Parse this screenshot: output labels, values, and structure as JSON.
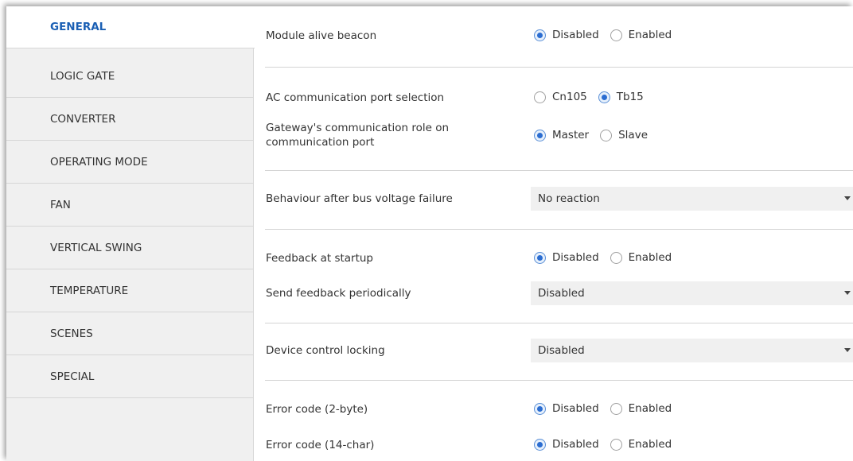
{
  "sidebar": {
    "items": [
      {
        "label": "GENERAL"
      },
      {
        "label": "LOGIC GATE"
      },
      {
        "label": "CONVERTER"
      },
      {
        "label": "OPERATING MODE"
      },
      {
        "label": "FAN"
      },
      {
        "label": "VERTICAL SWING"
      },
      {
        "label": "TEMPERATURE"
      },
      {
        "label": "SCENES"
      },
      {
        "label": "SPECIAL"
      }
    ]
  },
  "settings": {
    "beacon": {
      "label": "Module alive beacon",
      "opt1": "Disabled",
      "opt2": "Enabled",
      "selected": "Disabled"
    },
    "port": {
      "label": "AC communication port selection",
      "opt1": "Cn105",
      "opt2": "Tb15",
      "selected": "Tb15"
    },
    "role": {
      "label1": "Gateway's communication role on",
      "label2": "communication port",
      "opt1": "Master",
      "opt2": "Slave",
      "selected": "Master"
    },
    "bus_failure": {
      "label": "Behaviour after bus voltage failure",
      "value": "No reaction"
    },
    "feedback_startup": {
      "label": "Feedback at startup",
      "opt1": "Disabled",
      "opt2": "Enabled",
      "selected": "Disabled"
    },
    "feedback_periodic": {
      "label": "Send feedback periodically",
      "value": "Disabled"
    },
    "locking": {
      "label": "Device control locking",
      "value": "Disabled"
    },
    "error_2byte": {
      "label": "Error code (2-byte)",
      "opt1": "Disabled",
      "opt2": "Enabled",
      "selected": "Disabled"
    },
    "error_14char": {
      "label": "Error code (14-char)",
      "opt1": "Disabled",
      "opt2": "Enabled",
      "selected": "Disabled"
    }
  },
  "colors": {
    "accent": "#1a5fb4",
    "sidebar_bg": "#f0f0f0",
    "select_bg": "#f0f0f0"
  }
}
